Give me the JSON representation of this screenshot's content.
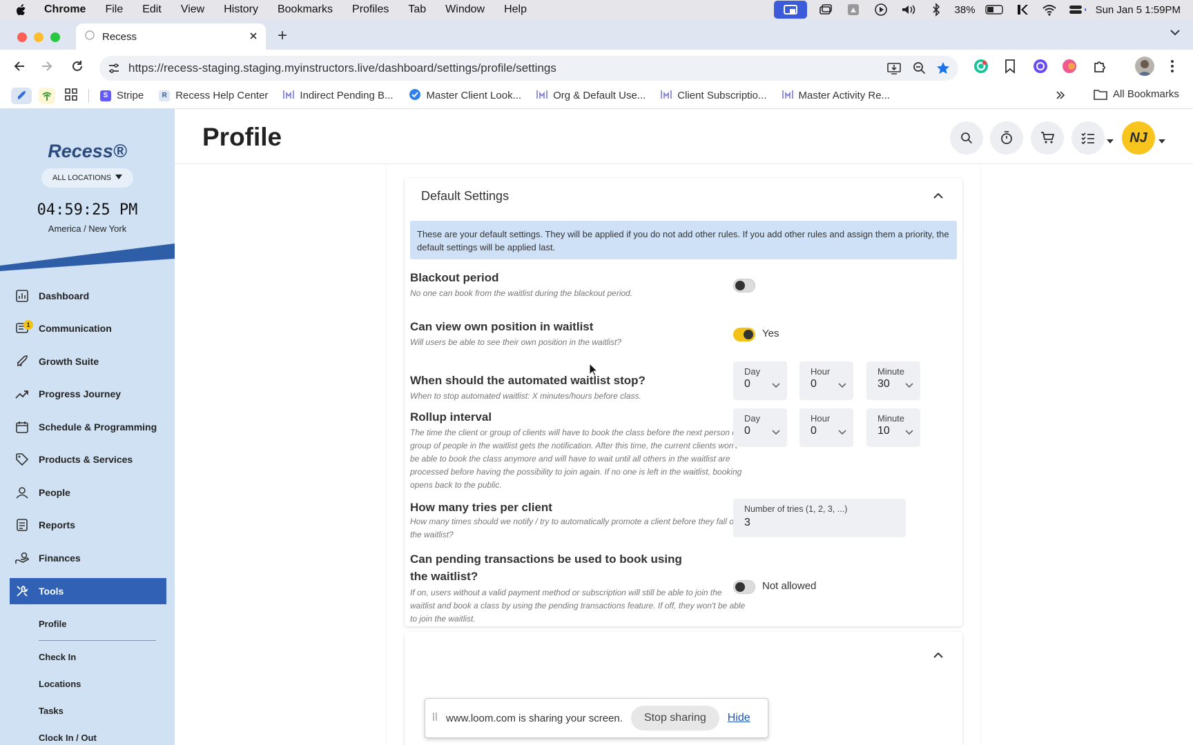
{
  "menubar": {
    "app": "Chrome",
    "items": [
      "File",
      "Edit",
      "View",
      "History",
      "Bookmarks",
      "Profiles",
      "Tab",
      "Window",
      "Help"
    ],
    "battery": "38%",
    "datetime": "Sun Jan 5  1:59PM"
  },
  "browser": {
    "tab_title": "Recess",
    "url": "https://recess-staging.staging.myinstructors.live/dashboard/settings/profile/settings",
    "bookmarks": [
      {
        "label": "Stripe",
        "icon": "stripe-icon",
        "color": "#635bff"
      },
      {
        "label": "Recess Help Center",
        "icon": "recess-icon",
        "color": "#8aa6cf"
      },
      {
        "label": "Indirect Pending B...",
        "icon": "sheet-icon",
        "color": "#7a7ad6"
      },
      {
        "label": "Master Client Look...",
        "icon": "check-icon",
        "color": "#2f80ed"
      },
      {
        "label": "Org & Default Use...",
        "icon": "sheet-icon",
        "color": "#7a7ad6"
      },
      {
        "label": "Client Subscriptio...",
        "icon": "sheet-icon",
        "color": "#7a7ad6"
      },
      {
        "label": "Master Activity Re...",
        "icon": "sheet-icon",
        "color": "#7a7ad6"
      }
    ],
    "all_bookmarks": "All Bookmarks"
  },
  "sidebar": {
    "logo": "Recess®",
    "location_button": "ALL LOCATIONS",
    "clock": "04:59:25 PM",
    "timezone": "America / New York",
    "nav": [
      {
        "label": "Dashboard",
        "icon": "dashboard-icon"
      },
      {
        "label": "Communication",
        "icon": "communication-icon",
        "badge": "1"
      },
      {
        "label": "Growth Suite",
        "icon": "rocket-icon"
      },
      {
        "label": "Progress Journey",
        "icon": "trend-icon"
      },
      {
        "label": "Schedule & Programming",
        "icon": "calendar-icon"
      },
      {
        "label": "Products & Services",
        "icon": "tag-icon"
      },
      {
        "label": "People",
        "icon": "people-icon"
      },
      {
        "label": "Reports",
        "icon": "reports-icon"
      },
      {
        "label": "Finances",
        "icon": "finances-icon"
      },
      {
        "label": "Tools",
        "icon": "tools-icon",
        "active": true
      }
    ],
    "subnav": [
      "Profile",
      "Check In",
      "Locations",
      "Tasks",
      "Clock In / Out"
    ]
  },
  "header": {
    "title": "Profile",
    "avatar_initials": "NJ"
  },
  "card": {
    "title": "Default Settings",
    "info": "These are your default settings. They will be applied if you do not add other rules. If you add other rules and assign them a priority, the default settings will be applied last.",
    "blackout": {
      "title": "Blackout period",
      "desc": "No one can book from the waitlist during the blackout period.",
      "on": false
    },
    "view_position": {
      "title": "Can view own position in waitlist",
      "desc": "Will users be able to see their own position in the waitlist?",
      "on": true,
      "label": "Yes"
    },
    "auto_stop": {
      "title": "When should the automated waitlist stop?",
      "desc": "When to stop automated waitlist: X minutes/hours before class.",
      "day_label": "Day",
      "day": "0",
      "hour_label": "Hour",
      "hour": "0",
      "minute_label": "Minute",
      "minute": "30"
    },
    "rollup": {
      "title": "Rollup interval",
      "desc": "The time the client or group of clients will have to book the class before the next person or group of people in the waitlist gets the notification. After this time, the current clients won't be able to book the class anymore and will have to wait until all others in the waitlist are processed before having the possibility to join again. If no one is left in the waitlist, booking opens back to the public.",
      "day_label": "Day",
      "day": "0",
      "hour_label": "Hour",
      "hour": "0",
      "minute_label": "Minute",
      "minute": "10"
    },
    "tries": {
      "title": "How many tries per client",
      "desc": "How many times should we notify / try to automatically promote a client before they fall off the waitlist?",
      "label": "Number of tries (1, 2, 3, ...)",
      "value": "3"
    },
    "pending": {
      "title": "Can pending transactions be used to book using the waitlist?",
      "desc": "If on, users without a valid payment method or subscription will still be able to join the waitlist and book a class by using the pending transactions feature. If off, they won't be able to join the waitlist.",
      "on": false,
      "label": "Not allowed"
    }
  },
  "loom": {
    "message": "www.loom.com is sharing your screen.",
    "stop": "Stop sharing",
    "hide": "Hide"
  }
}
